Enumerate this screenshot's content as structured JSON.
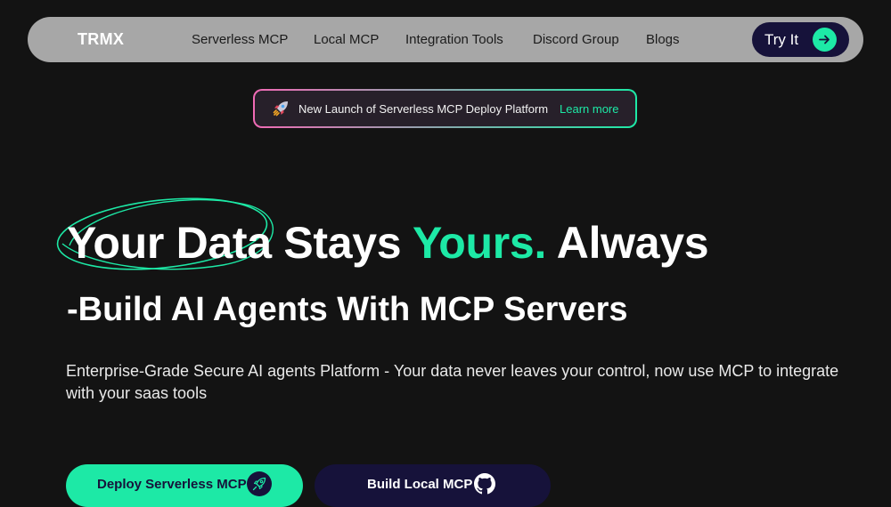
{
  "nav": {
    "brand": "TRMX",
    "links": [
      "Serverless MCP",
      "Local MCP",
      "Integration Tools",
      "Discord Group",
      "Blogs"
    ],
    "cta_label": "Try It"
  },
  "announcement": {
    "text": "New Launch of Serverless MCP Deploy Platform",
    "link_label": "Learn more"
  },
  "hero": {
    "title_part1": "Your Data Stays ",
    "title_accent": "Yours.",
    "title_part2": " Always",
    "subtitle": "-Build AI Agents With MCP Servers",
    "description": "Enterprise-Grade Secure AI agents Platform - Your data never leaves your control, now use MCP to integrate with your saas tools"
  },
  "buttons": {
    "primary_label": "Deploy Serverless MCP",
    "secondary_label": "Build Local MCP"
  },
  "colors": {
    "accent": "#1de9a6",
    "navy": "#16123a",
    "background": "#131313",
    "nav_bg": "#a7a7a7",
    "pink": "#f06ab5"
  },
  "icons": {
    "try_arrow": "arrow-right-icon",
    "announce": "rocket-icon",
    "primary_button": "rocket-icon",
    "secondary_button": "github-icon",
    "title_decoration": "scribble-circle"
  }
}
